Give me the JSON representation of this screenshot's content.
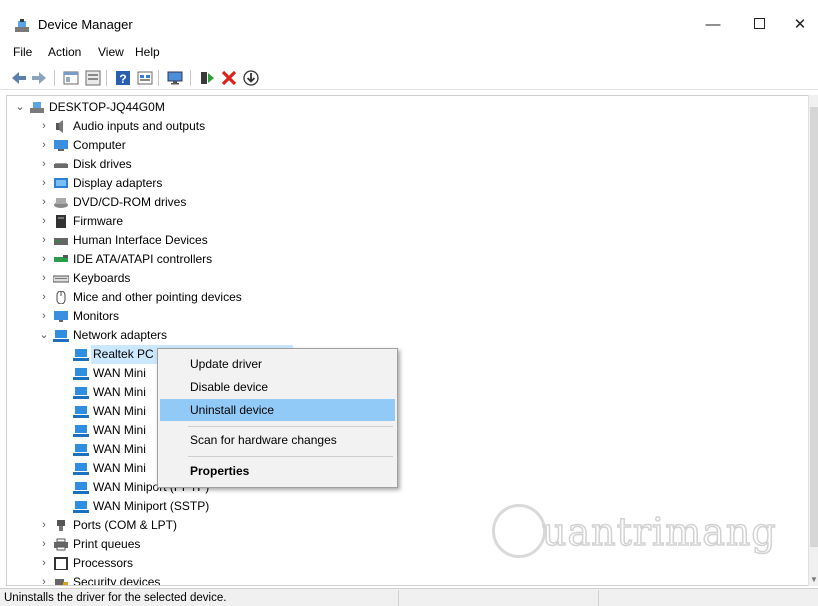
{
  "window": {
    "title": "Device Manager",
    "min": "—",
    "close": "✕"
  },
  "menu": {
    "file": "File",
    "action": "Action",
    "view": "View",
    "help": "Help"
  },
  "toolbar_icons": [
    "back-icon",
    "forward-icon",
    "properties-pane-icon",
    "update-driver-list-icon",
    "help-icon",
    "device-list-icon",
    "monitor-icon",
    "add-driver-icon",
    "uninstall-x-icon",
    "download-icon"
  ],
  "tree": {
    "root": "DESKTOP-JQ44G0M",
    "categories": [
      {
        "label": "Audio inputs and outputs",
        "icon": "speaker-icon"
      },
      {
        "label": "Computer",
        "icon": "computer-icon"
      },
      {
        "label": "Disk drives",
        "icon": "disk-drive-icon"
      },
      {
        "label": "Display adapters",
        "icon": "display-adapter-icon"
      },
      {
        "label": "DVD/CD-ROM drives",
        "icon": "dvd-drive-icon"
      },
      {
        "label": "Firmware",
        "icon": "firmware-icon"
      },
      {
        "label": "Human Interface Devices",
        "icon": "hid-icon"
      },
      {
        "label": "IDE ATA/ATAPI controllers",
        "icon": "ide-controller-icon"
      },
      {
        "label": "Keyboards",
        "icon": "keyboard-icon"
      },
      {
        "label": "Mice and other pointing devices",
        "icon": "mouse-icon"
      },
      {
        "label": "Monitors",
        "icon": "monitor-icon"
      },
      {
        "label": "Network adapters",
        "icon": "network-adapter-icon"
      }
    ],
    "network_children": [
      "Realtek PC",
      "WAN Mini",
      "WAN Mini",
      "WAN Mini",
      "WAN Mini",
      "WAN Mini",
      "WAN Mini",
      "WAN Miniport (PPTP)",
      "WAN Miniport (SSTP)"
    ],
    "after": [
      {
        "label": "Ports (COM & LPT)",
        "icon": "port-icon"
      },
      {
        "label": "Print queues",
        "icon": "printer-icon"
      },
      {
        "label": "Processors",
        "icon": "processor-icon"
      },
      {
        "label": "Security devices",
        "icon": "security-icon"
      }
    ]
  },
  "context_menu": {
    "update": "Update driver",
    "disable": "Disable device",
    "uninstall": "Uninstall device",
    "scan": "Scan for hardware changes",
    "properties": "Properties"
  },
  "watermark": "uantrimang",
  "status": {
    "text": "Uninstalls the driver for the selected device."
  },
  "colors": {
    "selection": "#cce8ff",
    "menu_highlight": "#91c9f7",
    "netblue": "#1e7fd6"
  }
}
